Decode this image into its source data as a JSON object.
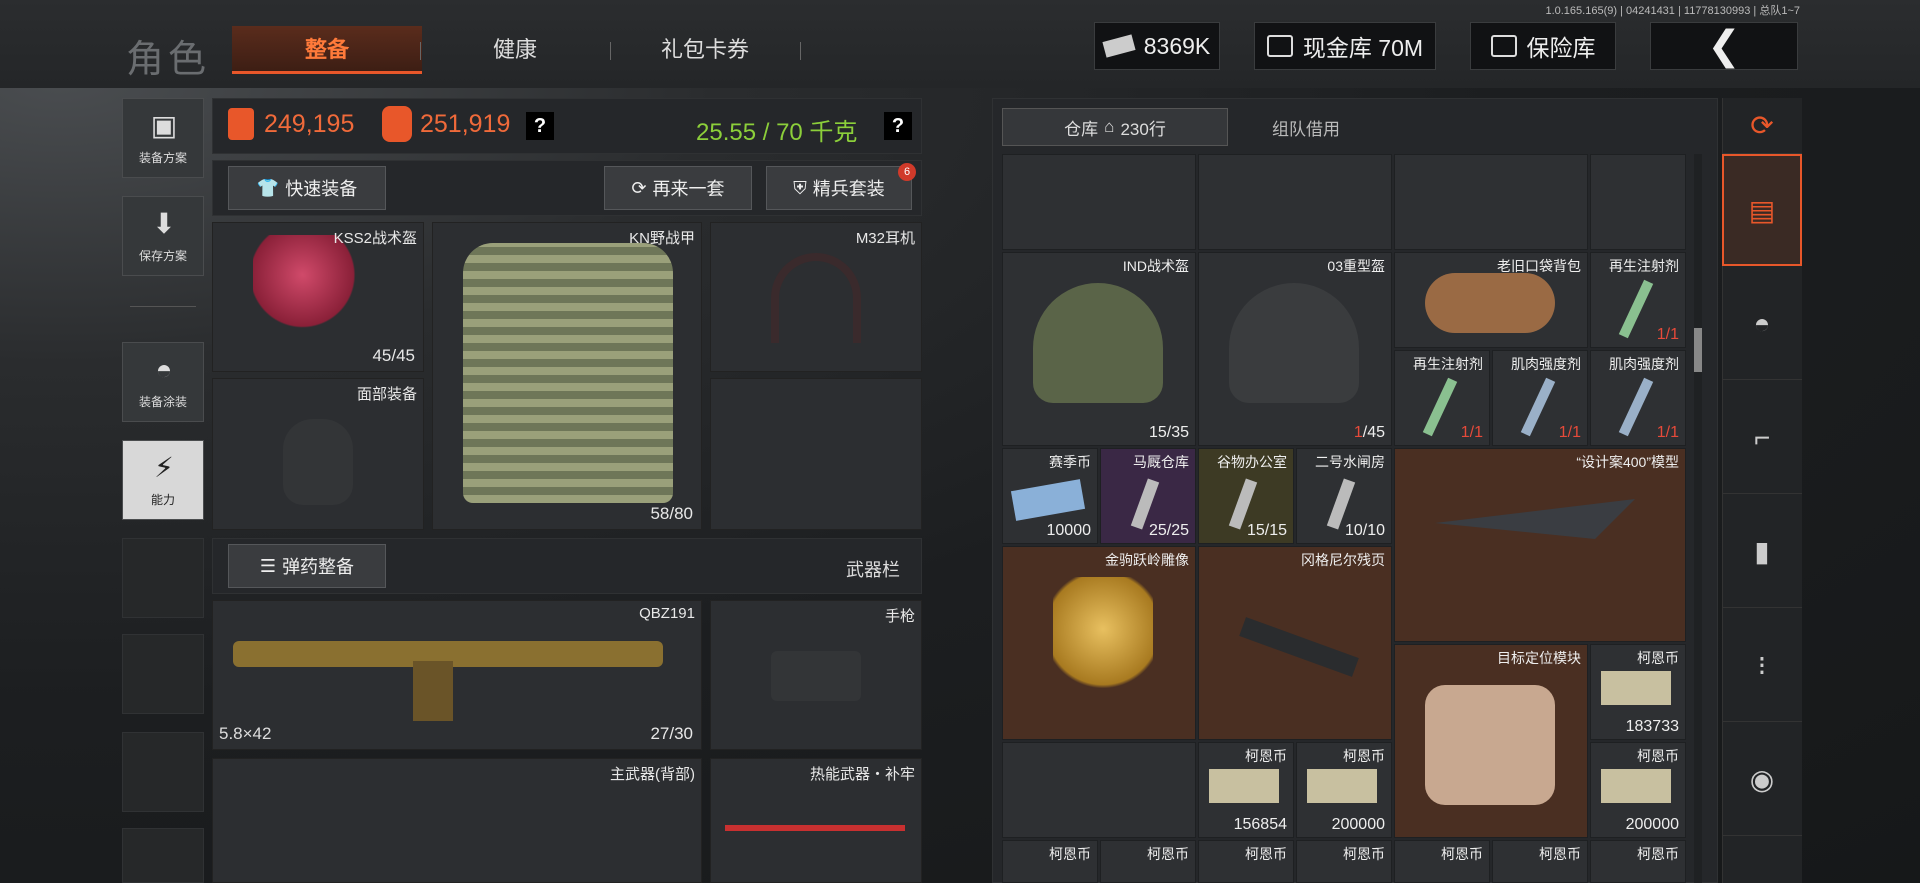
{
  "version": "1.0.165.165(9) | 04241431 | 11778130993 | 总队1~7",
  "header": {
    "title": "角色",
    "tabs": [
      "整备",
      "健康",
      "礼包卡券"
    ],
    "currency": "8369K",
    "cash_vault": "现金库 70M",
    "safe": "保险库"
  },
  "left_menu": [
    {
      "label": "装备方案",
      "icon": "vest-icon"
    },
    {
      "label": "保存方案",
      "icon": "download-icon"
    },
    {
      "label": "装备涂装",
      "icon": "helmet-paint-icon"
    },
    {
      "label": "能力",
      "icon": "lightning-icon"
    }
  ],
  "stats": {
    "value_a": "249,195",
    "value_b": "251,919",
    "weight": "25.55 / 70 千克",
    "help": "?"
  },
  "actions": {
    "quick": "快速装备",
    "again": "再来一套",
    "elite": "精兵套装",
    "elite_badge": "6",
    "ammo": "弹药整备",
    "weapon_bar": "武器栏"
  },
  "gear": {
    "helmet": {
      "name": "KSS2战术盔",
      "dur": "45/45"
    },
    "armor": {
      "name": "KN野战甲",
      "dur": "58/80"
    },
    "headset": {
      "name": "M32耳机"
    },
    "face": {
      "name": "面部装备"
    }
  },
  "weapons": {
    "primary": {
      "name": "QBZ191",
      "caliber": "5.8×42",
      "ammo": "27/30"
    },
    "pistol": {
      "name": "手枪"
    },
    "back": {
      "name": "主武器(背部)"
    },
    "melee": {
      "name": "热能武器・补牢"
    }
  },
  "warehouse": {
    "tab_main": "仓库",
    "rows": "230行",
    "tab_team": "组队借用",
    "items": {
      "ind": {
        "name": "IND战术盔",
        "ct": "15/35"
      },
      "h03": {
        "name": "03重型盔",
        "ct": "1",
        "ct2": "/45"
      },
      "bag": {
        "name": "老旧口袋背包"
      },
      "regen1": {
        "name": "再生注射剂",
        "ct": "1/1"
      },
      "regen2": {
        "name": "再生注射剂",
        "ct": "1/1"
      },
      "muscle1": {
        "name": "肌肉强度剂",
        "ct": "1/1"
      },
      "muscle2": {
        "name": "肌肉强度剂",
        "ct": "1/1"
      },
      "season": {
        "name": "赛季币",
        "ct": "10000"
      },
      "stable": {
        "name": "马厩仓库",
        "ct": "25/25"
      },
      "office": {
        "name": "谷物办公室",
        "ct": "15/15"
      },
      "gate": {
        "name": "二号水闸房",
        "ct": "10/10"
      },
      "model": {
        "name": "“设计案400”模型"
      },
      "horse": {
        "name": "金驹跃岭雕像"
      },
      "scroll": {
        "name": "冈格尼尔残页"
      },
      "locator": {
        "name": "目标定位模块"
      },
      "coin1": {
        "name": "柯恩币",
        "ct": "183733"
      },
      "coin2": {
        "name": "柯恩币",
        "ct": "156854"
      },
      "coin3": {
        "name": "柯恩币",
        "ct": "200000"
      },
      "coin4": {
        "name": "柯恩币",
        "ct": "200000"
      },
      "row": [
        "柯恩币",
        "柯恩币",
        "柯恩币",
        "柯恩币",
        "柯恩币",
        "柯恩币",
        "柯恩币"
      ]
    }
  }
}
